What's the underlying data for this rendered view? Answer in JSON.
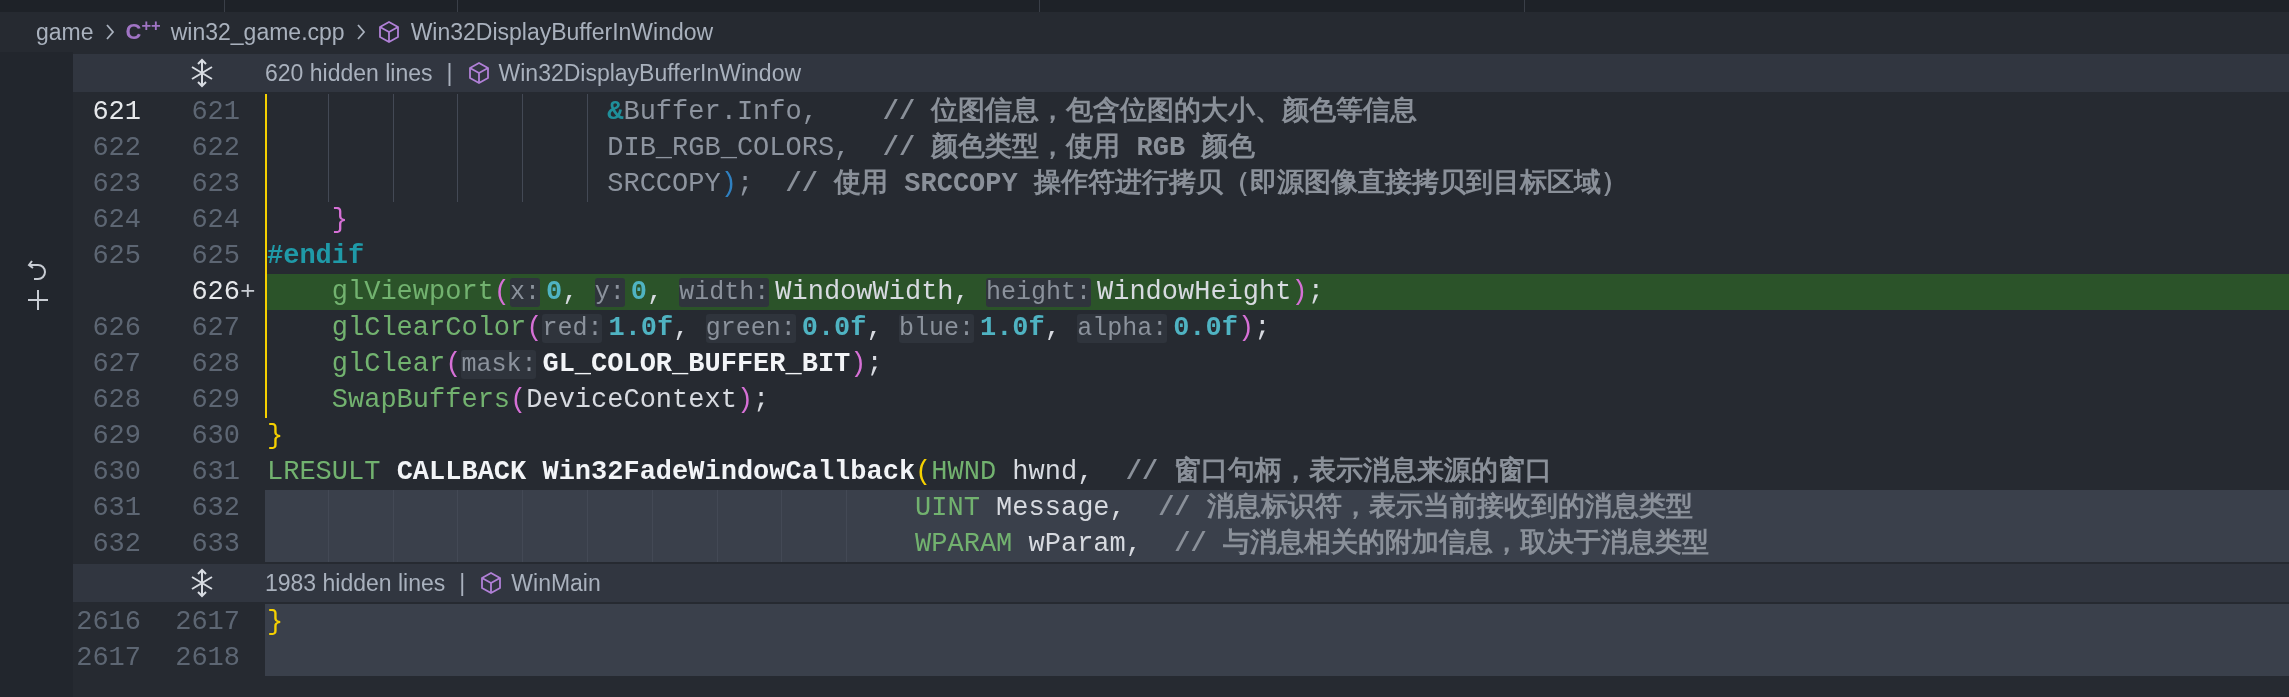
{
  "breadcrumb": [
    {
      "kind": "folder",
      "text": "game"
    },
    {
      "kind": "file",
      "icon": "C$^{++}$",
      "text": "win32_game.cpp"
    },
    {
      "kind": "symbol",
      "text": "Win32DisplayBufferInWindow"
    }
  ],
  "blocks": [
    {
      "kind": "hidden",
      "label": "620 hidden lines",
      "separator": "|",
      "symbol": "Win32DisplayBufferInWindow"
    },
    {
      "kind": "context",
      "old": "621",
      "new": "621",
      "current": true,
      "in_scope": true,
      "shaded": false,
      "tokens": [
        {
          "kind": "op",
          "text": "                     &"
        },
        {
          "kind": "dim",
          "text": "Buffer.Info,    "
        },
        {
          "kind": "comment",
          "text": "// 位图信息，包含位图的大小、颜色等信息"
        }
      ]
    },
    {
      "kind": "context",
      "old": "622",
      "new": "622",
      "current": false,
      "in_scope": true,
      "shaded": false,
      "tokens": [
        {
          "kind": "dim",
          "text": "                     DIB_RGB_COLORS,  "
        },
        {
          "kind": "comment",
          "text": "// 颜色类型，使用 RGB 颜色"
        }
      ]
    },
    {
      "kind": "context",
      "old": "623",
      "new": "623",
      "current": false,
      "in_scope": true,
      "shaded": false,
      "tokens": [
        {
          "kind": "dim",
          "text": "                     SRCCOPY"
        },
        {
          "kind": "p3",
          "text": ")"
        },
        {
          "kind": "dim",
          "text": ";  "
        },
        {
          "kind": "comment",
          "text": "// 使用 SRCCOPY 操作符进行拷贝（即源图像直接拷贝到目标区域）"
        }
      ]
    },
    {
      "kind": "context",
      "old": "624",
      "new": "624",
      "current": false,
      "in_scope": true,
      "shaded": false,
      "tokens": [
        {
          "kind": "p1",
          "text": "    }"
        }
      ]
    },
    {
      "kind": "context",
      "old": "625",
      "new": "625",
      "current": false,
      "in_scope": true,
      "shaded": false,
      "tokens": [
        {
          "kind": "directive",
          "text": "#endif"
        }
      ]
    },
    {
      "kind": "added",
      "new": "626",
      "marker": "+",
      "current": true,
      "in_scope": true,
      "tokens": [
        {
          "kind": "fn",
          "text": "    glViewport"
        },
        {
          "kind": "p1",
          "text": "("
        },
        {
          "kind": "hint",
          "text": "x:"
        },
        {
          "kind": "num",
          "text": "0"
        },
        {
          "kind": "id",
          "text": ", "
        },
        {
          "kind": "hint",
          "text": "y:"
        },
        {
          "kind": "num",
          "text": "0"
        },
        {
          "kind": "id",
          "text": ", "
        },
        {
          "kind": "hint",
          "text": "width:"
        },
        {
          "kind": "id",
          "text": "WindowWidth, "
        },
        {
          "kind": "hint",
          "text": "height:"
        },
        {
          "kind": "id",
          "text": "WindowHeight"
        },
        {
          "kind": "p1",
          "text": ")"
        },
        {
          "kind": "id",
          "text": ";"
        }
      ]
    },
    {
      "kind": "context",
      "old": "626",
      "new": "627",
      "current": false,
      "in_scope": true,
      "shaded": false,
      "tokens": [
        {
          "kind": "fn",
          "text": "    glClearColor"
        },
        {
          "kind": "p1",
          "text": "("
        },
        {
          "kind": "hint",
          "text": "red:"
        },
        {
          "kind": "num",
          "text": "1.0f"
        },
        {
          "kind": "id",
          "text": ", "
        },
        {
          "kind": "hint",
          "text": "green:"
        },
        {
          "kind": "num",
          "text": "0.0f"
        },
        {
          "kind": "id",
          "text": ", "
        },
        {
          "kind": "hint",
          "text": "blue:"
        },
        {
          "kind": "num",
          "text": "1.0f"
        },
        {
          "kind": "id",
          "text": ", "
        },
        {
          "kind": "hint",
          "text": "alpha:"
        },
        {
          "kind": "num",
          "text": "0.0f"
        },
        {
          "kind": "p1",
          "text": ")"
        },
        {
          "kind": "id",
          "text": ";"
        }
      ]
    },
    {
      "kind": "context",
      "old": "627",
      "new": "628",
      "current": false,
      "in_scope": true,
      "shaded": false,
      "tokens": [
        {
          "kind": "fn",
          "text": "    glClear"
        },
        {
          "kind": "p1",
          "text": "("
        },
        {
          "kind": "hint",
          "text": "mask:"
        },
        {
          "kind": "macro",
          "text": "GL_COLOR_BUFFER_BIT"
        },
        {
          "kind": "p1",
          "text": ")"
        },
        {
          "kind": "id",
          "text": ";"
        }
      ]
    },
    {
      "kind": "context",
      "old": "628",
      "new": "629",
      "current": false,
      "in_scope": true,
      "shaded": false,
      "tokens": [
        {
          "kind": "fn",
          "text": "    SwapBuffers"
        },
        {
          "kind": "p1",
          "text": "("
        },
        {
          "kind": "id",
          "text": "DeviceContext"
        },
        {
          "kind": "p1",
          "text": ")"
        },
        {
          "kind": "id",
          "text": ";"
        }
      ]
    },
    {
      "kind": "context",
      "old": "629",
      "new": "630",
      "current": false,
      "in_scope": false,
      "shaded": false,
      "tokens": [
        {
          "kind": "p2",
          "text": "}"
        }
      ]
    },
    {
      "kind": "context",
      "old": "630",
      "new": "631",
      "current": false,
      "in_scope": false,
      "shaded": false,
      "tokens": [
        {
          "kind": "type",
          "text": "LRESULT "
        },
        {
          "kind": "macro",
          "text": "CALLBACK Win32FadeWindowCallback"
        },
        {
          "kind": "p2",
          "text": "("
        },
        {
          "kind": "type",
          "text": "HWND"
        },
        {
          "kind": "id",
          "text": " hwnd,  "
        },
        {
          "kind": "comment",
          "text": "// 窗口句柄，表示消息来源的窗口"
        }
      ]
    },
    {
      "kind": "context",
      "old": "631",
      "new": "632",
      "current": false,
      "in_scope": false,
      "shaded": true,
      "tokens": [
        {
          "kind": "type",
          "text": "                                        UINT"
        },
        {
          "kind": "id",
          "text": " Message,  "
        },
        {
          "kind": "comment",
          "text": "// 消息标识符，表示当前接收到的消息类型"
        }
      ]
    },
    {
      "kind": "context",
      "old": "632",
      "new": "633",
      "current": false,
      "in_scope": false,
      "shaded": true,
      "tokens": [
        {
          "kind": "type",
          "text": "                                        WPARAM"
        },
        {
          "kind": "id",
          "text": " wParam,  "
        },
        {
          "kind": "comment",
          "text": "// 与消息相关的附加信息，取决于消息类型"
        }
      ]
    },
    {
      "kind": "hidden",
      "label": "1983 hidden lines",
      "separator": "|",
      "symbol": "WinMain"
    },
    {
      "kind": "context",
      "old": "2616",
      "new": "2617",
      "current": false,
      "in_scope": false,
      "shaded": true,
      "tokens": [
        {
          "kind": "p2",
          "text": "}"
        }
      ]
    },
    {
      "kind": "context",
      "old": "2617",
      "new": "2618",
      "current": false,
      "in_scope": false,
      "shaded": true
    }
  ]
}
